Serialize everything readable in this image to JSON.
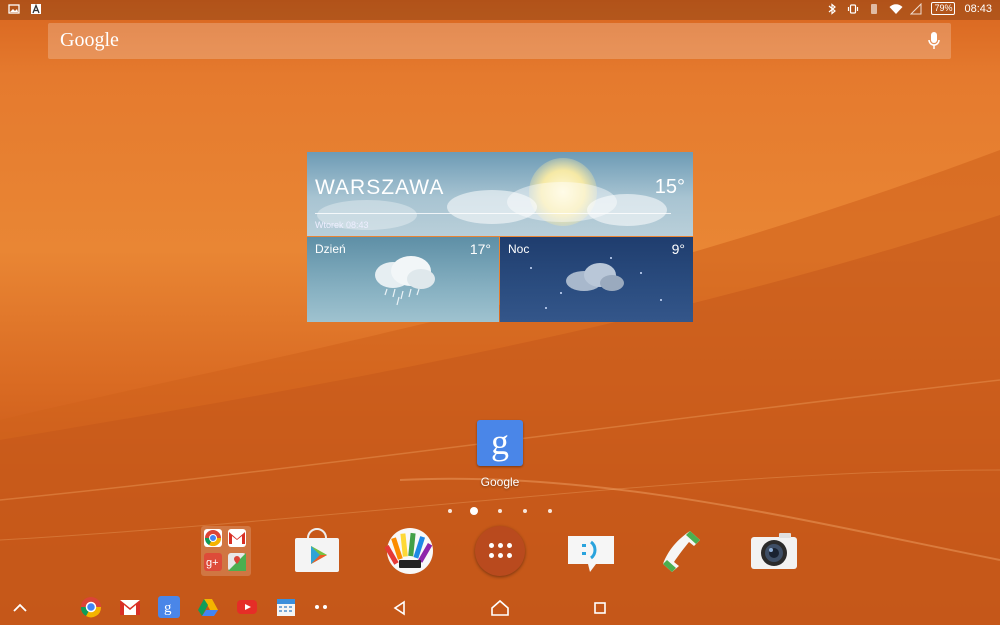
{
  "status_bar": {
    "left_icons": [
      "gallery-icon",
      "font-icon"
    ],
    "right_icons": [
      "bluetooth-icon",
      "vibrate-icon",
      "nfc-icon",
      "wifi-icon",
      "signal-icon"
    ],
    "battery": "79%",
    "time": "08:43"
  },
  "search": {
    "logo_text": "Google",
    "mic_icon": "mic-icon"
  },
  "weather": {
    "city": "WARSZAWA",
    "current_temp": "15°",
    "date": "Wtorek 08:43",
    "day": {
      "label": "Dzień",
      "temp": "17°"
    },
    "night": {
      "label": "Noc",
      "temp": "9°"
    }
  },
  "home_app": {
    "label": "Google",
    "icon_letter": "g"
  },
  "pager": {
    "count": 5,
    "active": 1
  },
  "dock": [
    {
      "name": "google-apps-folder",
      "icon": "folder-icon"
    },
    {
      "name": "play-store",
      "icon": "play-store-icon"
    },
    {
      "name": "sketch",
      "icon": "sketch-icon"
    },
    {
      "name": "all-apps",
      "icon": "apps-grid-icon"
    },
    {
      "name": "messaging",
      "icon": "messaging-icon"
    },
    {
      "name": "phone",
      "icon": "phone-icon"
    },
    {
      "name": "camera",
      "icon": "camera-icon"
    }
  ],
  "navbar": {
    "shortcuts": [
      "chrome-icon",
      "gmail-icon",
      "google-search-icon",
      "drive-icon",
      "youtube-icon",
      "calendar-icon",
      "more-icon"
    ],
    "buttons": [
      "back-icon",
      "home-icon",
      "recents-icon"
    ]
  },
  "colors": {
    "wallpaper": "#e57a2e",
    "google_blue": "#4a86e8"
  }
}
